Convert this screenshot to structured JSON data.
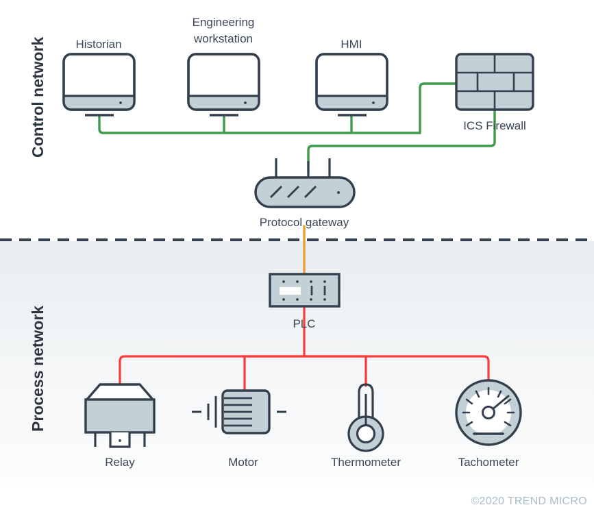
{
  "diagram": {
    "title_visible": false,
    "zones": [
      {
        "id": "control",
        "label": "Control network",
        "background": "#ffffff"
      },
      {
        "id": "process",
        "label": "Process network",
        "background_top": "#e9eef1",
        "background_bottom": "#fbfcfc"
      }
    ],
    "nodes": [
      {
        "id": "historian",
        "label": "Historian",
        "icon": "monitor-icon",
        "zone": "control"
      },
      {
        "id": "engineering",
        "label": "Engineering\nworkstation",
        "label_line1": "Engineering",
        "label_line2": "workstation",
        "icon": "monitor-icon",
        "zone": "control"
      },
      {
        "id": "hmi",
        "label": "HMI",
        "icon": "monitor-icon",
        "zone": "control"
      },
      {
        "id": "ics-firewall",
        "label": "ICS Firewall",
        "icon": "brick-wall-icon",
        "zone": "control"
      },
      {
        "id": "protocol-gateway",
        "label": "Protocol gateway",
        "icon": "gateway-icon",
        "zone": "control"
      },
      {
        "id": "plc",
        "label": "PLC",
        "icon": "plc-icon",
        "zone": "process"
      },
      {
        "id": "relay",
        "label": "Relay",
        "icon": "relay-icon",
        "zone": "process"
      },
      {
        "id": "motor",
        "label": "Motor",
        "icon": "motor-icon",
        "zone": "process"
      },
      {
        "id": "thermometer",
        "label": "Thermometer",
        "icon": "thermometer-icon",
        "zone": "process"
      },
      {
        "id": "tachometer",
        "label": "Tachometer",
        "icon": "tachometer-icon",
        "zone": "process"
      }
    ],
    "links": [
      {
        "from": "historian",
        "to": "control-bus",
        "color": "#3f9c4d"
      },
      {
        "from": "engineering",
        "to": "control-bus",
        "color": "#3f9c4d"
      },
      {
        "from": "hmi",
        "to": "control-bus",
        "color": "#3f9c4d"
      },
      {
        "from": "ics-firewall",
        "to": "protocol-gateway",
        "color": "#3f9c4d"
      },
      {
        "from": "control-bus",
        "to": "ics-firewall",
        "color": "#3f9c4d"
      },
      {
        "from": "protocol-gateway",
        "to": "plc",
        "color": "#e8a33d"
      },
      {
        "from": "plc",
        "to": "relay",
        "color": "#fa3c3c"
      },
      {
        "from": "plc",
        "to": "motor",
        "color": "#fa3c3c"
      },
      {
        "from": "plc",
        "to": "thermometer",
        "color": "#fa3c3c"
      },
      {
        "from": "plc",
        "to": "tachometer",
        "color": "#fa3c3c"
      }
    ],
    "colors": {
      "stroke": "#333f4d",
      "device_fill": "#c3d0d6",
      "screen_fill": "#ffffff",
      "cable_green": "#3f9c4d",
      "cable_orange": "#e8a33d",
      "cable_red": "#fa3c3c",
      "divider": "#333f4d",
      "label_text": "#3b4756",
      "zone_text": "#2b3440",
      "copyright_text": "#a9bcc8"
    },
    "divider": {
      "style": "dashed",
      "label": "network-boundary"
    }
  },
  "footer": {
    "copyright": "©2020 TREND MICRO"
  }
}
